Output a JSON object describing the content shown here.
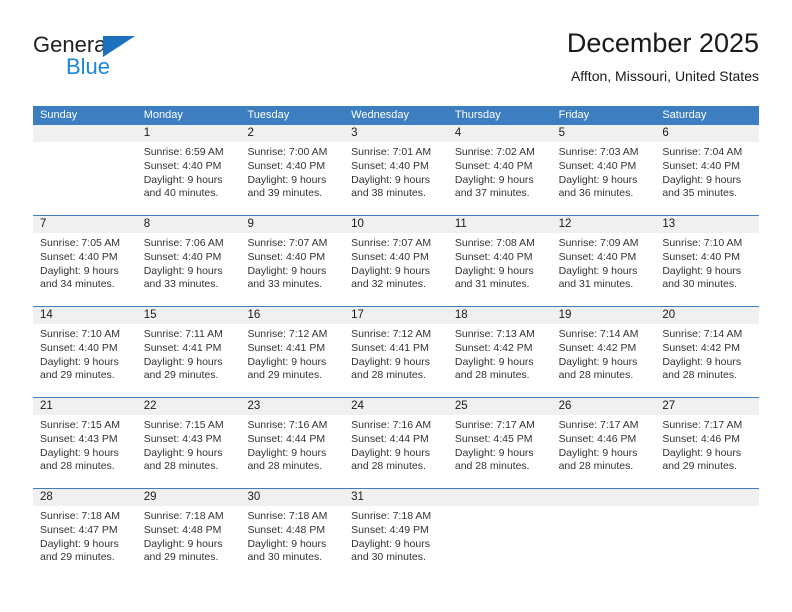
{
  "brand": {
    "name_part1": "General",
    "name_part2": "Blue",
    "triangle_color": "#1c71bd",
    "blue_color": "#1c86d6"
  },
  "header": {
    "title": "December 2025",
    "subtitle": "Affton, Missouri, United States"
  },
  "theme": {
    "header_blue": "#3c7ebf",
    "daynum_band": "#f0f0f0"
  },
  "calendar": {
    "weekdays": [
      "Sunday",
      "Monday",
      "Tuesday",
      "Wednesday",
      "Thursday",
      "Friday",
      "Saturday"
    ],
    "weeks": [
      [
        {
          "day": "",
          "lines": []
        },
        {
          "day": "1",
          "lines": [
            "Sunrise: 6:59 AM",
            "Sunset: 4:40 PM",
            "Daylight: 9 hours",
            "and 40 minutes."
          ]
        },
        {
          "day": "2",
          "lines": [
            "Sunrise: 7:00 AM",
            "Sunset: 4:40 PM",
            "Daylight: 9 hours",
            "and 39 minutes."
          ]
        },
        {
          "day": "3",
          "lines": [
            "Sunrise: 7:01 AM",
            "Sunset: 4:40 PM",
            "Daylight: 9 hours",
            "and 38 minutes."
          ]
        },
        {
          "day": "4",
          "lines": [
            "Sunrise: 7:02 AM",
            "Sunset: 4:40 PM",
            "Daylight: 9 hours",
            "and 37 minutes."
          ]
        },
        {
          "day": "5",
          "lines": [
            "Sunrise: 7:03 AM",
            "Sunset: 4:40 PM",
            "Daylight: 9 hours",
            "and 36 minutes."
          ]
        },
        {
          "day": "6",
          "lines": [
            "Sunrise: 7:04 AM",
            "Sunset: 4:40 PM",
            "Daylight: 9 hours",
            "and 35 minutes."
          ]
        }
      ],
      [
        {
          "day": "7",
          "lines": [
            "Sunrise: 7:05 AM",
            "Sunset: 4:40 PM",
            "Daylight: 9 hours",
            "and 34 minutes."
          ]
        },
        {
          "day": "8",
          "lines": [
            "Sunrise: 7:06 AM",
            "Sunset: 4:40 PM",
            "Daylight: 9 hours",
            "and 33 minutes."
          ]
        },
        {
          "day": "9",
          "lines": [
            "Sunrise: 7:07 AM",
            "Sunset: 4:40 PM",
            "Daylight: 9 hours",
            "and 33 minutes."
          ]
        },
        {
          "day": "10",
          "lines": [
            "Sunrise: 7:07 AM",
            "Sunset: 4:40 PM",
            "Daylight: 9 hours",
            "and 32 minutes."
          ]
        },
        {
          "day": "11",
          "lines": [
            "Sunrise: 7:08 AM",
            "Sunset: 4:40 PM",
            "Daylight: 9 hours",
            "and 31 minutes."
          ]
        },
        {
          "day": "12",
          "lines": [
            "Sunrise: 7:09 AM",
            "Sunset: 4:40 PM",
            "Daylight: 9 hours",
            "and 31 minutes."
          ]
        },
        {
          "day": "13",
          "lines": [
            "Sunrise: 7:10 AM",
            "Sunset: 4:40 PM",
            "Daylight: 9 hours",
            "and 30 minutes."
          ]
        }
      ],
      [
        {
          "day": "14",
          "lines": [
            "Sunrise: 7:10 AM",
            "Sunset: 4:40 PM",
            "Daylight: 9 hours",
            "and 29 minutes."
          ]
        },
        {
          "day": "15",
          "lines": [
            "Sunrise: 7:11 AM",
            "Sunset: 4:41 PM",
            "Daylight: 9 hours",
            "and 29 minutes."
          ]
        },
        {
          "day": "16",
          "lines": [
            "Sunrise: 7:12 AM",
            "Sunset: 4:41 PM",
            "Daylight: 9 hours",
            "and 29 minutes."
          ]
        },
        {
          "day": "17",
          "lines": [
            "Sunrise: 7:12 AM",
            "Sunset: 4:41 PM",
            "Daylight: 9 hours",
            "and 28 minutes."
          ]
        },
        {
          "day": "18",
          "lines": [
            "Sunrise: 7:13 AM",
            "Sunset: 4:42 PM",
            "Daylight: 9 hours",
            "and 28 minutes."
          ]
        },
        {
          "day": "19",
          "lines": [
            "Sunrise: 7:14 AM",
            "Sunset: 4:42 PM",
            "Daylight: 9 hours",
            "and 28 minutes."
          ]
        },
        {
          "day": "20",
          "lines": [
            "Sunrise: 7:14 AM",
            "Sunset: 4:42 PM",
            "Daylight: 9 hours",
            "and 28 minutes."
          ]
        }
      ],
      [
        {
          "day": "21",
          "lines": [
            "Sunrise: 7:15 AM",
            "Sunset: 4:43 PM",
            "Daylight: 9 hours",
            "and 28 minutes."
          ]
        },
        {
          "day": "22",
          "lines": [
            "Sunrise: 7:15 AM",
            "Sunset: 4:43 PM",
            "Daylight: 9 hours",
            "and 28 minutes."
          ]
        },
        {
          "day": "23",
          "lines": [
            "Sunrise: 7:16 AM",
            "Sunset: 4:44 PM",
            "Daylight: 9 hours",
            "and 28 minutes."
          ]
        },
        {
          "day": "24",
          "lines": [
            "Sunrise: 7:16 AM",
            "Sunset: 4:44 PM",
            "Daylight: 9 hours",
            "and 28 minutes."
          ]
        },
        {
          "day": "25",
          "lines": [
            "Sunrise: 7:17 AM",
            "Sunset: 4:45 PM",
            "Daylight: 9 hours",
            "and 28 minutes."
          ]
        },
        {
          "day": "26",
          "lines": [
            "Sunrise: 7:17 AM",
            "Sunset: 4:46 PM",
            "Daylight: 9 hours",
            "and 28 minutes."
          ]
        },
        {
          "day": "27",
          "lines": [
            "Sunrise: 7:17 AM",
            "Sunset: 4:46 PM",
            "Daylight: 9 hours",
            "and 29 minutes."
          ]
        }
      ],
      [
        {
          "day": "28",
          "lines": [
            "Sunrise: 7:18 AM",
            "Sunset: 4:47 PM",
            "Daylight: 9 hours",
            "and 29 minutes."
          ]
        },
        {
          "day": "29",
          "lines": [
            "Sunrise: 7:18 AM",
            "Sunset: 4:48 PM",
            "Daylight: 9 hours",
            "and 29 minutes."
          ]
        },
        {
          "day": "30",
          "lines": [
            "Sunrise: 7:18 AM",
            "Sunset: 4:48 PM",
            "Daylight: 9 hours",
            "and 30 minutes."
          ]
        },
        {
          "day": "31",
          "lines": [
            "Sunrise: 7:18 AM",
            "Sunset: 4:49 PM",
            "Daylight: 9 hours",
            "and 30 minutes."
          ]
        },
        {
          "day": "",
          "lines": []
        },
        {
          "day": "",
          "lines": []
        },
        {
          "day": "",
          "lines": []
        }
      ]
    ]
  }
}
